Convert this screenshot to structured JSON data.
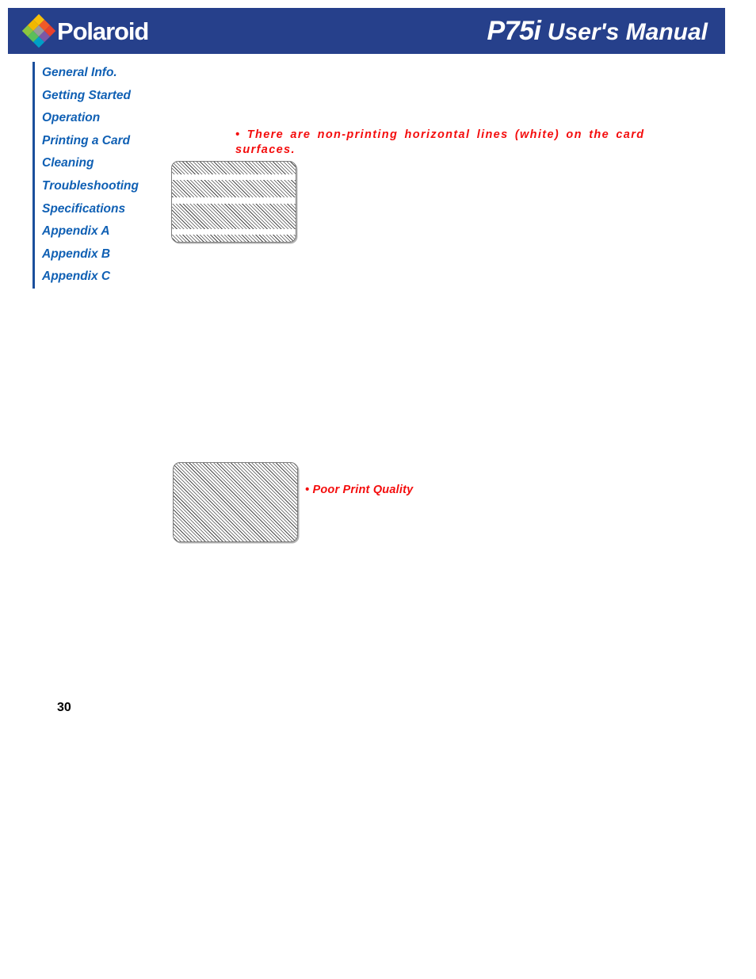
{
  "header": {
    "brand": "Polaroid",
    "logo_icon": "polaroid-diamond-logo",
    "title_model": "P75i",
    "title_rest": " User's Manual",
    "background_color": "#26408b",
    "text_color": "#ffffff",
    "logo_colors": [
      "#f0b800",
      "#f05a28",
      "#e8412c",
      "#f7c00a",
      "#9b9b9b",
      "#7b58a6",
      "#8cc63f",
      "#5bbf5a",
      "#00a0c6"
    ]
  },
  "sidebar": {
    "accent_color": "#1b4f9c",
    "link_color": "#1060b4",
    "items": [
      {
        "label": "General Info."
      },
      {
        "label": "Getting Started"
      },
      {
        "label": "Operation"
      },
      {
        "label": "Printing a Card"
      },
      {
        "label": "Cleaning"
      },
      {
        "label": "Troubleshooting"
      },
      {
        "label": "Specifications"
      },
      {
        "label": "Appendix A"
      },
      {
        "label": "Appendix B"
      },
      {
        "label": "Appendix C"
      }
    ]
  },
  "content": {
    "note_color": "#f40d0d",
    "note_lines": "• There are non-printing horizontal lines (white) on the card surfaces.",
    "note_quality": "• Poor Print Quality",
    "card_lines_caption": "card sample with white horizontal non-printing bands",
    "card_quality_caption": "card sample with uniform poor print quality hatching"
  },
  "footer": {
    "page_number": "30"
  }
}
